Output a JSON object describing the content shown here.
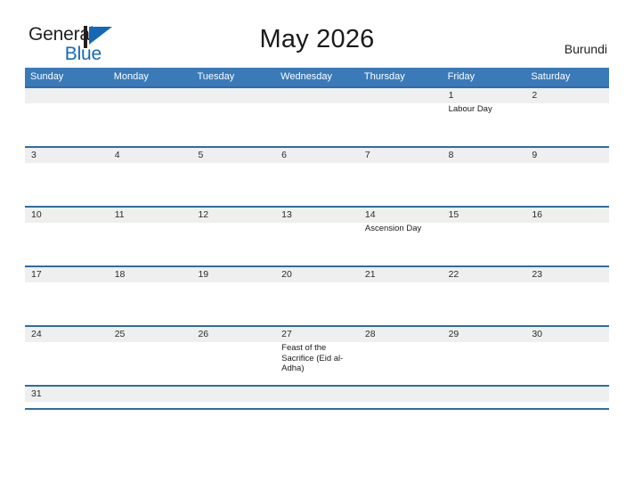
{
  "brand": {
    "name_part1": "General",
    "name_part2": "Blue",
    "flag_icon": "blue-triangle-flag-icon",
    "accent_color": "#1469b5"
  },
  "header": {
    "title": "May 2026",
    "country": "Burundi"
  },
  "theme": {
    "header_blue": "#3a7ab8",
    "row_border_blue": "#2e6da4",
    "date_band_gray": "#efefef"
  },
  "calendar": {
    "month": "May",
    "year": "2026",
    "weekday_headers": [
      "Sunday",
      "Monday",
      "Tuesday",
      "Wednesday",
      "Thursday",
      "Friday",
      "Saturday"
    ],
    "weeks": [
      {
        "dates": [
          "",
          "",
          "",
          "",
          "",
          "1",
          "2"
        ],
        "events": [
          "",
          "",
          "",
          "",
          "",
          "Labour Day",
          ""
        ]
      },
      {
        "dates": [
          "3",
          "4",
          "5",
          "6",
          "7",
          "8",
          "9"
        ],
        "events": [
          "",
          "",
          "",
          "",
          "",
          "",
          ""
        ]
      },
      {
        "dates": [
          "10",
          "11",
          "12",
          "13",
          "14",
          "15",
          "16"
        ],
        "events": [
          "",
          "",
          "",
          "",
          "Ascension Day",
          "",
          ""
        ]
      },
      {
        "dates": [
          "17",
          "18",
          "19",
          "20",
          "21",
          "22",
          "23"
        ],
        "events": [
          "",
          "",
          "",
          "",
          "",
          "",
          ""
        ]
      },
      {
        "dates": [
          "24",
          "25",
          "26",
          "27",
          "28",
          "29",
          "30"
        ],
        "events": [
          "",
          "",
          "",
          "Feast of the Sacrifice (Eid al-Adha)",
          "",
          "",
          ""
        ]
      },
      {
        "dates": [
          "31",
          "",
          "",
          "",
          "",
          "",
          ""
        ],
        "events": [
          "",
          "",
          "",
          "",
          "",
          "",
          ""
        ]
      }
    ]
  }
}
